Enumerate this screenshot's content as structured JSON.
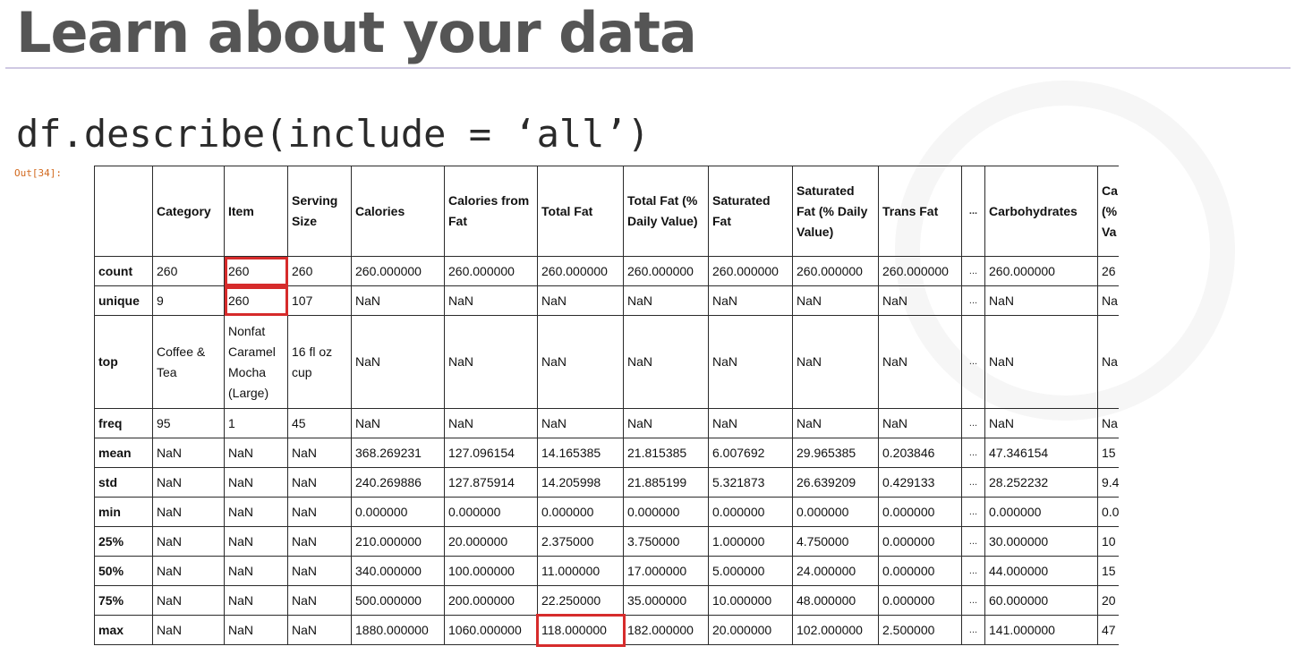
{
  "slide": {
    "title": "Learn about your data",
    "code": "df.describe(include = ‘all’)"
  },
  "notebook": {
    "out_prompt": "Out[34]:"
  },
  "describe_table": {
    "columns": [
      "",
      "Category",
      "Item",
      "Serving Size",
      "Calories",
      "Calories from Fat",
      "Total Fat",
      "Total Fat (% Daily Value)",
      "Saturated Fat",
      "Saturated Fat (% Daily Value)",
      "Trans Fat",
      "...",
      "Carbohydrates",
      "Ca (% Va"
    ],
    "rows": [
      [
        "count",
        "260",
        "260",
        "260",
        "260.000000",
        "260.000000",
        "260.000000",
        "260.000000",
        "260.000000",
        "260.000000",
        "260.000000",
        "...",
        "260.000000",
        "26"
      ],
      [
        "unique",
        "9",
        "260",
        "107",
        "NaN",
        "NaN",
        "NaN",
        "NaN",
        "NaN",
        "NaN",
        "NaN",
        "...",
        "NaN",
        "Na"
      ],
      [
        "top",
        "Coffee & Tea",
        "Nonfat Caramel Mocha (Large)",
        "16 fl oz cup",
        "NaN",
        "NaN",
        "NaN",
        "NaN",
        "NaN",
        "NaN",
        "NaN",
        "...",
        "NaN",
        "Na"
      ],
      [
        "freq",
        "95",
        "1",
        "45",
        "NaN",
        "NaN",
        "NaN",
        "NaN",
        "NaN",
        "NaN",
        "NaN",
        "...",
        "NaN",
        "Na"
      ],
      [
        "mean",
        "NaN",
        "NaN",
        "NaN",
        "368.269231",
        "127.096154",
        "14.165385",
        "21.815385",
        "6.007692",
        "29.965385",
        "0.203846",
        "...",
        "47.346154",
        "15"
      ],
      [
        "std",
        "NaN",
        "NaN",
        "NaN",
        "240.269886",
        "127.875914",
        "14.205998",
        "21.885199",
        "5.321873",
        "26.639209",
        "0.429133",
        "...",
        "28.252232",
        "9.4"
      ],
      [
        "min",
        "NaN",
        "NaN",
        "NaN",
        "0.000000",
        "0.000000",
        "0.000000",
        "0.000000",
        "0.000000",
        "0.000000",
        "0.000000",
        "...",
        "0.000000",
        "0.0"
      ],
      [
        "25%",
        "NaN",
        "NaN",
        "NaN",
        "210.000000",
        "20.000000",
        "2.375000",
        "3.750000",
        "1.000000",
        "4.750000",
        "0.000000",
        "...",
        "30.000000",
        "10"
      ],
      [
        "50%",
        "NaN",
        "NaN",
        "NaN",
        "340.000000",
        "100.000000",
        "11.000000",
        "17.000000",
        "5.000000",
        "24.000000",
        "0.000000",
        "...",
        "44.000000",
        "15"
      ],
      [
        "75%",
        "NaN",
        "NaN",
        "NaN",
        "500.000000",
        "200.000000",
        "22.250000",
        "35.000000",
        "10.000000",
        "48.000000",
        "0.000000",
        "...",
        "60.000000",
        "20"
      ],
      [
        "max",
        "NaN",
        "NaN",
        "NaN",
        "1880.000000",
        "1060.000000",
        "118.000000",
        "182.000000",
        "20.000000",
        "102.000000",
        "2.500000",
        "...",
        "141.000000",
        "47"
      ]
    ],
    "highlight_color": "#d62b2b"
  }
}
